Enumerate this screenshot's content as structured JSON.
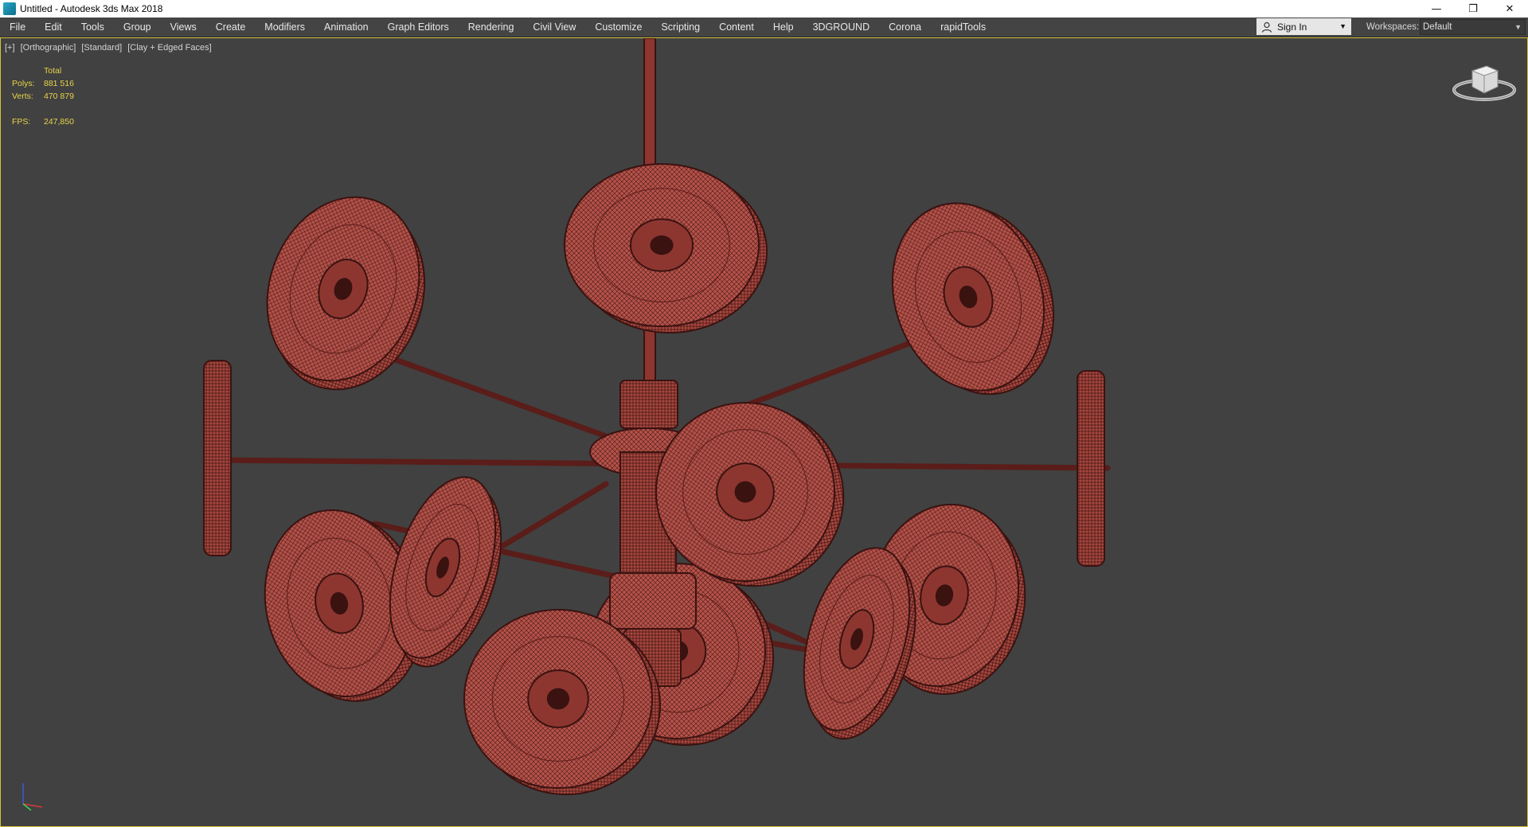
{
  "window": {
    "title": "Untitled - Autodesk 3ds Max 2018",
    "controls": [
      "minimize-icon",
      "restore-icon",
      "close-icon"
    ]
  },
  "menu": [
    "File",
    "Edit",
    "Tools",
    "Group",
    "Views",
    "Create",
    "Modifiers",
    "Animation",
    "Graph Editors",
    "Rendering",
    "Civil View",
    "Customize",
    "Scripting",
    "Content",
    "Help",
    "3DGROUND",
    "Corona",
    "rapidTools"
  ],
  "account": {
    "sign_in": "Sign In",
    "icon": "user-icon"
  },
  "workspaces": {
    "label": "Workspaces:",
    "value": "Default"
  },
  "viewport": {
    "labels": [
      "[+]",
      "[Orthographic]",
      "[Standard]",
      "[Clay + Edged Faces]"
    ],
    "stats": {
      "header": "Total",
      "polys_label": "Polys:",
      "polys": "881 516",
      "verts_label": "Verts:",
      "verts": "470 879",
      "fps_label": "FPS:",
      "fps": "247,850"
    },
    "colors": {
      "background": "#414141",
      "border": "#d8c23a",
      "stats_text": "#e7d44a",
      "model": "#b5524a"
    },
    "navigation": {
      "viewcube": "viewcube-icon",
      "axis": "axis-tripod-icon"
    }
  }
}
